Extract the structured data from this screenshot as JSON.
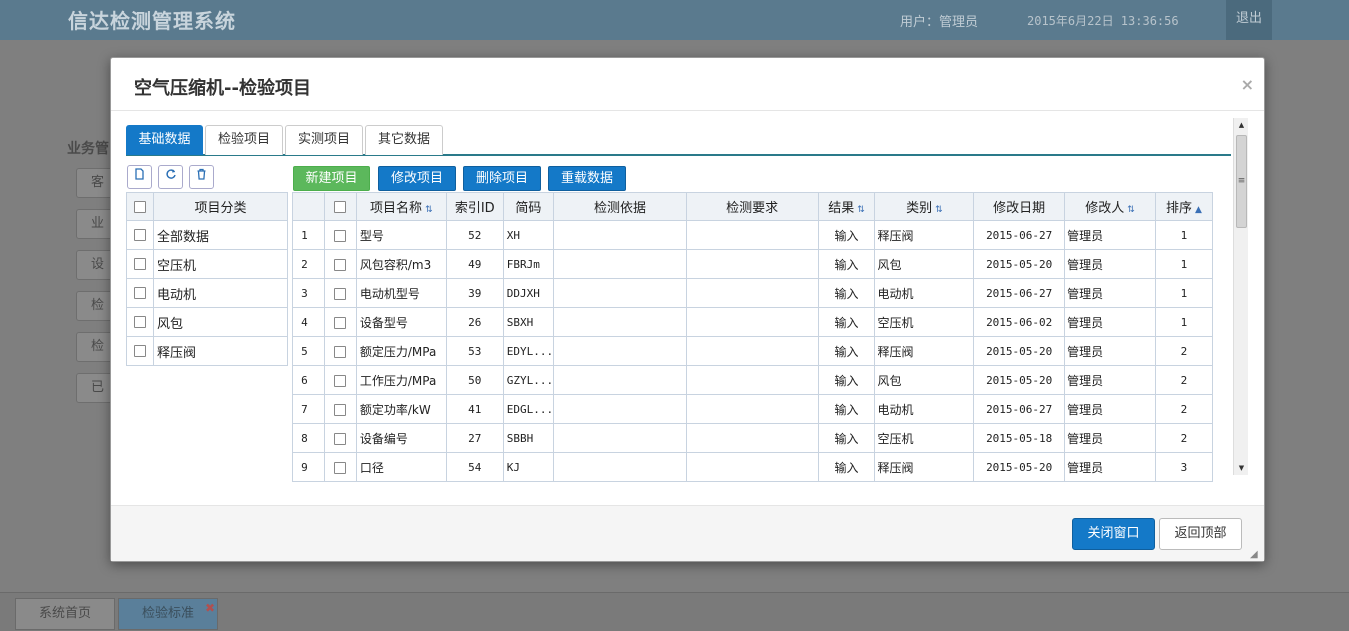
{
  "app": {
    "title": "信达检测管理系统",
    "user": "用户：管理员",
    "datetime": "2015年6月22日 13:36:56",
    "logout": "退出"
  },
  "background": {
    "side_title": "业务管",
    "side_buttons": [
      "客户",
      "业务",
      "设备",
      "检测",
      "检测",
      "已完"
    ]
  },
  "bottom_tabs": [
    {
      "label": "系统首页"
    },
    {
      "label": "检验标准",
      "close": "✖"
    }
  ],
  "modal": {
    "title": "空气压缩机--检验项目",
    "close": "×",
    "tabs": [
      "基础数据",
      "检验项目",
      "实测项目",
      "其它数据"
    ],
    "icon_buttons": [
      "new-doc-icon",
      "refresh-icon",
      "trash-icon"
    ],
    "actions": {
      "new": "新建项目",
      "edit": "修改项目",
      "delete": "删除项目",
      "reload": "重载数据"
    },
    "category_header": "项目分类",
    "categories": [
      "全部数据",
      "空压机",
      "电动机",
      "风包",
      "释压阀"
    ],
    "columns": {
      "name": "项目名称",
      "index_id": "索引ID",
      "code": "简码",
      "basis": "检测依据",
      "requirement": "检测要求",
      "result": "结果",
      "type": "类别",
      "modified_date": "修改日期",
      "modifier": "修改人",
      "order": "排序"
    },
    "rows": [
      {
        "no": "1",
        "name": "型号",
        "index_id": "52",
        "code": "XH",
        "basis": "",
        "requirement": "",
        "result": "输入",
        "type": "释压阀",
        "modified_date": "2015-06-27",
        "modifier": "管理员",
        "order": "1"
      },
      {
        "no": "2",
        "name": "风包容积/m3",
        "index_id": "49",
        "code": "FBRJm",
        "basis": "",
        "requirement": "",
        "result": "输入",
        "type": "风包",
        "modified_date": "2015-05-20",
        "modifier": "管理员",
        "order": "1"
      },
      {
        "no": "3",
        "name": "电动机型号",
        "index_id": "39",
        "code": "DDJXH",
        "basis": "",
        "requirement": "",
        "result": "输入",
        "type": "电动机",
        "modified_date": "2015-06-27",
        "modifier": "管理员",
        "order": "1"
      },
      {
        "no": "4",
        "name": "设备型号",
        "index_id": "26",
        "code": "SBXH",
        "basis": "",
        "requirement": "",
        "result": "输入",
        "type": "空压机",
        "modified_date": "2015-06-02",
        "modifier": "管理员",
        "order": "1"
      },
      {
        "no": "5",
        "name": "额定压力/MPa",
        "index_id": "53",
        "code": "EDYL...",
        "basis": "",
        "requirement": "",
        "result": "输入",
        "type": "释压阀",
        "modified_date": "2015-05-20",
        "modifier": "管理员",
        "order": "2"
      },
      {
        "no": "6",
        "name": "工作压力/MPa",
        "index_id": "50",
        "code": "GZYL...",
        "basis": "",
        "requirement": "",
        "result": "输入",
        "type": "风包",
        "modified_date": "2015-05-20",
        "modifier": "管理员",
        "order": "2"
      },
      {
        "no": "7",
        "name": "额定功率/kW",
        "index_id": "41",
        "code": "EDGL...",
        "basis": "",
        "requirement": "",
        "result": "输入",
        "type": "电动机",
        "modified_date": "2015-06-27",
        "modifier": "管理员",
        "order": "2"
      },
      {
        "no": "8",
        "name": "设备编号",
        "index_id": "27",
        "code": "SBBH",
        "basis": "",
        "requirement": "",
        "result": "输入",
        "type": "空压机",
        "modified_date": "2015-05-18",
        "modifier": "管理员",
        "order": "2"
      },
      {
        "no": "9",
        "name": "口径",
        "index_id": "54",
        "code": "KJ",
        "basis": "",
        "requirement": "",
        "result": "输入",
        "type": "释压阀",
        "modified_date": "2015-05-20",
        "modifier": "管理员",
        "order": "3"
      }
    ],
    "footer": {
      "close": "关闭窗口",
      "top": "返回顶部"
    }
  }
}
